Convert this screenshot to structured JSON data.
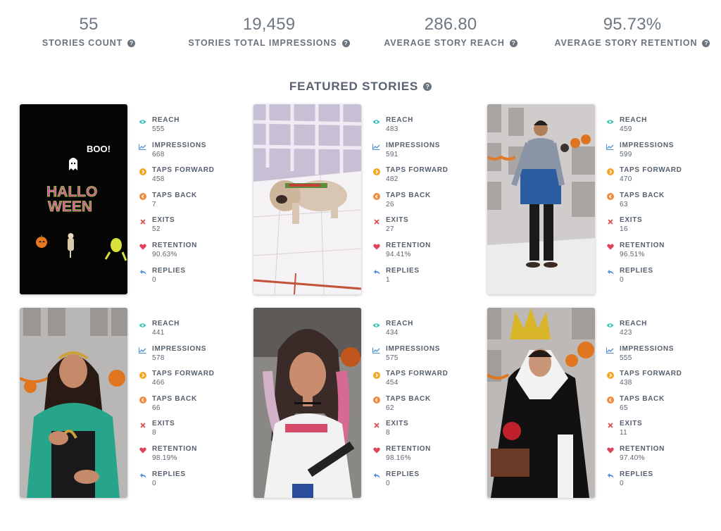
{
  "kpis": [
    {
      "value": "55",
      "label": "STORIES COUNT"
    },
    {
      "value": "19,459",
      "label": "STORIES TOTAL IMPRESSIONS"
    },
    {
      "value": "286.80",
      "label": "AVERAGE STORY REACH"
    },
    {
      "value": "95.73%",
      "label": "AVERAGE STORY RETENTION"
    }
  ],
  "section_title": "FEATURED STORIES",
  "help_glyph": "?",
  "stat_labels": {
    "reach": "REACH",
    "impressions": "IMPRESSIONS",
    "taps_forward": "TAPS FORWARD",
    "taps_back": "TAPS BACK",
    "exits": "EXITS",
    "retention": "RETENTION",
    "replies": "REPLIES"
  },
  "icon_colors": {
    "reach": "#2ec4b6",
    "impressions": "#4a90d9",
    "taps_forward": "#f5a623",
    "taps_back": "#f08a3c",
    "exits": "#e04a4a",
    "retention": "#e0445a",
    "replies": "#4a8fd8"
  },
  "stories": [
    {
      "reach": "555",
      "impressions": "668",
      "taps_forward": "458",
      "taps_back": "7",
      "exits": "52",
      "retention": "90.63%",
      "replies": "0",
      "image_text": {
        "boo": "BOO!",
        "line1": "HALLO",
        "line2": "WEEN"
      }
    },
    {
      "reach": "483",
      "impressions": "591",
      "taps_forward": "482",
      "taps_back": "26",
      "exits": "27",
      "retention": "94.41%",
      "replies": "1"
    },
    {
      "reach": "459",
      "impressions": "599",
      "taps_forward": "470",
      "taps_back": "63",
      "exits": "16",
      "retention": "96.51%",
      "replies": "0"
    },
    {
      "reach": "441",
      "impressions": "578",
      "taps_forward": "466",
      "taps_back": "66",
      "exits": "8",
      "retention": "98.19%",
      "replies": "0"
    },
    {
      "reach": "434",
      "impressions": "575",
      "taps_forward": "454",
      "taps_back": "62",
      "exits": "8",
      "retention": "98.16%",
      "replies": "0"
    },
    {
      "reach": "423",
      "impressions": "555",
      "taps_forward": "438",
      "taps_back": "65",
      "exits": "11",
      "retention": "97.40%",
      "replies": "0"
    }
  ]
}
